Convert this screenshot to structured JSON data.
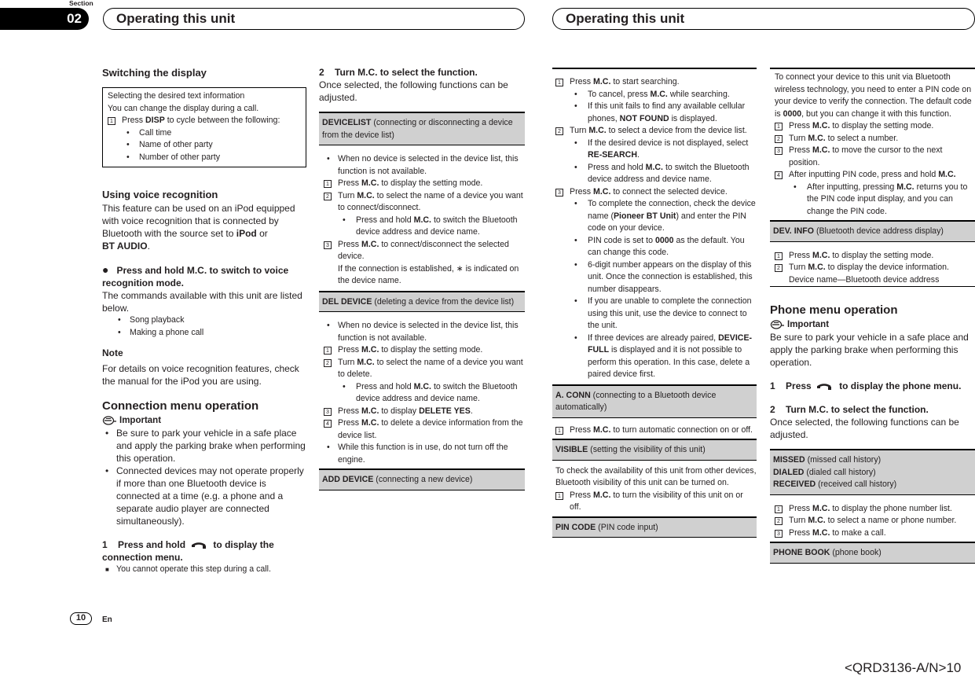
{
  "header": {
    "section_label": "Section",
    "section_number": "02",
    "title_left": "Operating this unit",
    "title_right": "Operating this unit"
  },
  "footer": {
    "page_number": "10",
    "language": "En",
    "doc_code": "<QRD3136-A/N>10"
  },
  "col1": {
    "switching": {
      "title": "Switching the display",
      "box_line1": "Selecting the desired text information",
      "box_line2": "You can change the display during a call.",
      "step1_pre": "Press ",
      "step1_bold": "DISP",
      "step1_post": " to cycle between the following:",
      "options": [
        "Call time",
        "Name of other party",
        "Number of other party"
      ]
    },
    "voice": {
      "title": "Using voice recognition",
      "intro_pre": "This feature can be used on an iPod equipped with voice recognition that is connected by Bluetooth with the source set to ",
      "intro_b1": "iPod",
      "intro_mid": " or ",
      "intro_b2": "BT AUDIO",
      "intro_end": ".",
      "action": "Press and hold M.C. to switch to voice recognition mode.",
      "commands_text": "The commands available with this unit are listed below.",
      "commands": [
        "Song playback",
        "Making a phone call"
      ],
      "note_title": "Note",
      "note_text": "For details on voice recognition features, check the manual for the iPod you are using."
    },
    "connection": {
      "title": "Connection menu operation",
      "important_label": "Important",
      "bullets": [
        "Be sure to park your vehicle in a safe place and apply the parking brake when performing this operation.",
        "Connected devices may not operate properly if more than one Bluetooth device is connected at a time (e.g. a phone and a separate audio player are connected simultaneously)."
      ],
      "step1_num": "1",
      "step1_pre": "Press and hold",
      "step1_post": "to display the connection menu.",
      "step1_note": "You cannot operate this step during a call."
    }
  },
  "col2": {
    "step2_num": "2",
    "step2_title": "Turn M.C. to select the function.",
    "step2_text": "Once selected, the following functions can be adjusted.",
    "devicelist": {
      "name": "DEVICELIST",
      "desc": " (connecting or disconnecting a device from the device list)",
      "bullet": "When no device is selected in the device list, this function is not available.",
      "s1_pre": "Press ",
      "s1_b": "M.C.",
      "s1_post": " to display the setting mode.",
      "s2_pre": "Turn ",
      "s2_b": "M.C.",
      "s2_post": " to select the name of a device you want to connect/disconnect.",
      "s2_sub_pre": "Press and hold ",
      "s2_sub_b": "M.C.",
      "s2_sub_post": " to switch the Bluetooth device address and device name.",
      "s3_pre": "Press ",
      "s3_b": "M.C.",
      "s3_post": " to connect/disconnect the selected device.",
      "s3_note": "If the connection is established, ∗ is indicated on the device name."
    },
    "deldevice": {
      "name": "DEL DEVICE",
      "desc": " (deleting a device from the device list)",
      "bullet": "When no device is selected in the device list, this function is not available.",
      "s1_pre": "Press ",
      "s1_b": "M.C.",
      "s1_post": " to display the setting mode.",
      "s2_pre": "Turn ",
      "s2_b": "M.C.",
      "s2_post": " to select the name of a device you want to delete.",
      "s2_sub_pre": "Press and hold ",
      "s2_sub_b": "M.C.",
      "s2_sub_post": " to switch the Bluetooth device address and device name.",
      "s3_pre": "Press ",
      "s3_b": "M.C.",
      "s3_mid": " to display ",
      "s3_b2": "DELETE YES",
      "s3_post": ".",
      "s4_pre": "Press ",
      "s4_b": "M.C.",
      "s4_post": " to delete a device information from the device list.",
      "bullet2": "While this function is in use, do not turn off the engine."
    },
    "adddevice": {
      "name": "ADD DEVICE",
      "desc": " (connecting a new device)"
    }
  },
  "col3": {
    "s1_pre": "Press ",
    "s1_b": "M.C.",
    "s1_post": " to start searching.",
    "s1_sub1_pre": "To cancel, press ",
    "s1_sub1_b": "M.C.",
    "s1_sub1_post": " while searching.",
    "s1_sub2_pre": "If this unit fails to find any available cellular phones, ",
    "s1_sub2_b": "NOT FOUND",
    "s1_sub2_post": " is displayed.",
    "s2_pre": "Turn ",
    "s2_b": "M.C.",
    "s2_post": " to select a device from the device list.",
    "s2_sub1_pre": "If the desired device is not displayed, select ",
    "s2_sub1_b": "RE-SEARCH",
    "s2_sub1_post": ".",
    "s2_sub2_pre": "Press and hold ",
    "s2_sub2_b": "M.C.",
    "s2_sub2_post": " to switch the Bluetooth device address and device name.",
    "s3_pre": "Press ",
    "s3_b": "M.C.",
    "s3_post": " to connect the selected device.",
    "s3_sub1_pre": "To complete the connection, check the device name (",
    "s3_sub1_b": "Pioneer BT Unit",
    "s3_sub1_post": ") and enter the PIN code on your device.",
    "s3_sub2_pre": "PIN code is set to ",
    "s3_sub2_b": "0000",
    "s3_sub2_post": " as the default. You can change this code.",
    "s3_sub3": "6-digit number appears on the display of this unit. Once the connection is established, this number disappears.",
    "s3_sub4": "If you are unable to complete the connection using this unit, use the device to connect to the unit.",
    "s3_sub5_pre": "If three devices are already paired, ",
    "s3_sub5_b": "DEVICE-FULL",
    "s3_sub5_post": " is displayed and it is not possible to perform this operation. In this case, delete a paired device first.",
    "aconn": {
      "name": "A. CONN",
      "desc": " (connecting to a Bluetooth device automatically)",
      "s1_pre": "Press ",
      "s1_b": "M.C.",
      "s1_post": " to turn automatic connection on or off."
    },
    "visible": {
      "name": "VISIBLE",
      "desc": " (setting the visibility of this unit)",
      "text": "To check the availability of this unit from other devices, Bluetooth visibility of this unit can be turned on.",
      "s1_pre": "Press ",
      "s1_b": "M.C.",
      "s1_post": " to turn the visibility of this unit on or off."
    },
    "pincode": {
      "name": "PIN CODE",
      "desc": " (PIN code input)"
    }
  },
  "col4": {
    "pin_text_pre": "To connect your device to this unit via Bluetooth wireless technology, you need to enter a PIN code on your device to verify the connection. The default code is ",
    "pin_text_b": "0000",
    "pin_text_post": ", but you can change it with this function.",
    "s1_pre": "Press ",
    "s1_b": "M.C.",
    "s1_post": " to display the setting mode.",
    "s2_pre": "Turn ",
    "s2_b": "M.C.",
    "s2_post": " to select a number.",
    "s3_pre": "Press ",
    "s3_b": "M.C.",
    "s3_post": " to move the cursor to the next position.",
    "s4_pre": "After inputting PIN code, press and hold ",
    "s4_b": "M.C.",
    "s4_sub_pre": "After inputting, pressing ",
    "s4_sub_b": "M.C.",
    "s4_sub_post": " returns you to the PIN code input display, and you can change the PIN code.",
    "devinfo": {
      "name": "DEV. INFO",
      "desc": " (Bluetooth device address display)",
      "s1_pre": "Press ",
      "s1_b": "M.C.",
      "s1_post": " to display the setting mode.",
      "s2_pre": "Turn ",
      "s2_b": "M.C.",
      "s2_post": " to display the device information.",
      "s2_note": "Device name—Bluetooth device address"
    },
    "phone": {
      "title": "Phone menu operation",
      "important_label": "Important",
      "important_text": "Be sure to park your vehicle in a safe place and apply the parking brake when performing this operation.",
      "step1_num": "1",
      "step1_pre": "Press",
      "step1_post": "to display the phone menu.",
      "step2_num": "2",
      "step2_title": "Turn M.C. to select the function.",
      "step2_text": "Once selected, the following functions can be adjusted.",
      "history": [
        {
          "name": "MISSED",
          "desc": " (missed call history)"
        },
        {
          "name": "DIALED",
          "desc": " (dialed call history)"
        },
        {
          "name": "RECEIVED",
          "desc": " (received call history)"
        }
      ],
      "h1_pre": "Press ",
      "h1_b": "M.C.",
      "h1_post": " to display the phone number list.",
      "h2_pre": "Turn ",
      "h2_b": "M.C.",
      "h2_post": " to select a name or phone number.",
      "h3_pre": "Press ",
      "h3_b": "M.C.",
      "h3_post": " to make a call.",
      "phonebook": {
        "name": "PHONE BOOK",
        "desc": " (phone book)"
      }
    }
  },
  "step_numbers": [
    "1",
    "2",
    "3",
    "4"
  ],
  "bullet_glyph": "•"
}
